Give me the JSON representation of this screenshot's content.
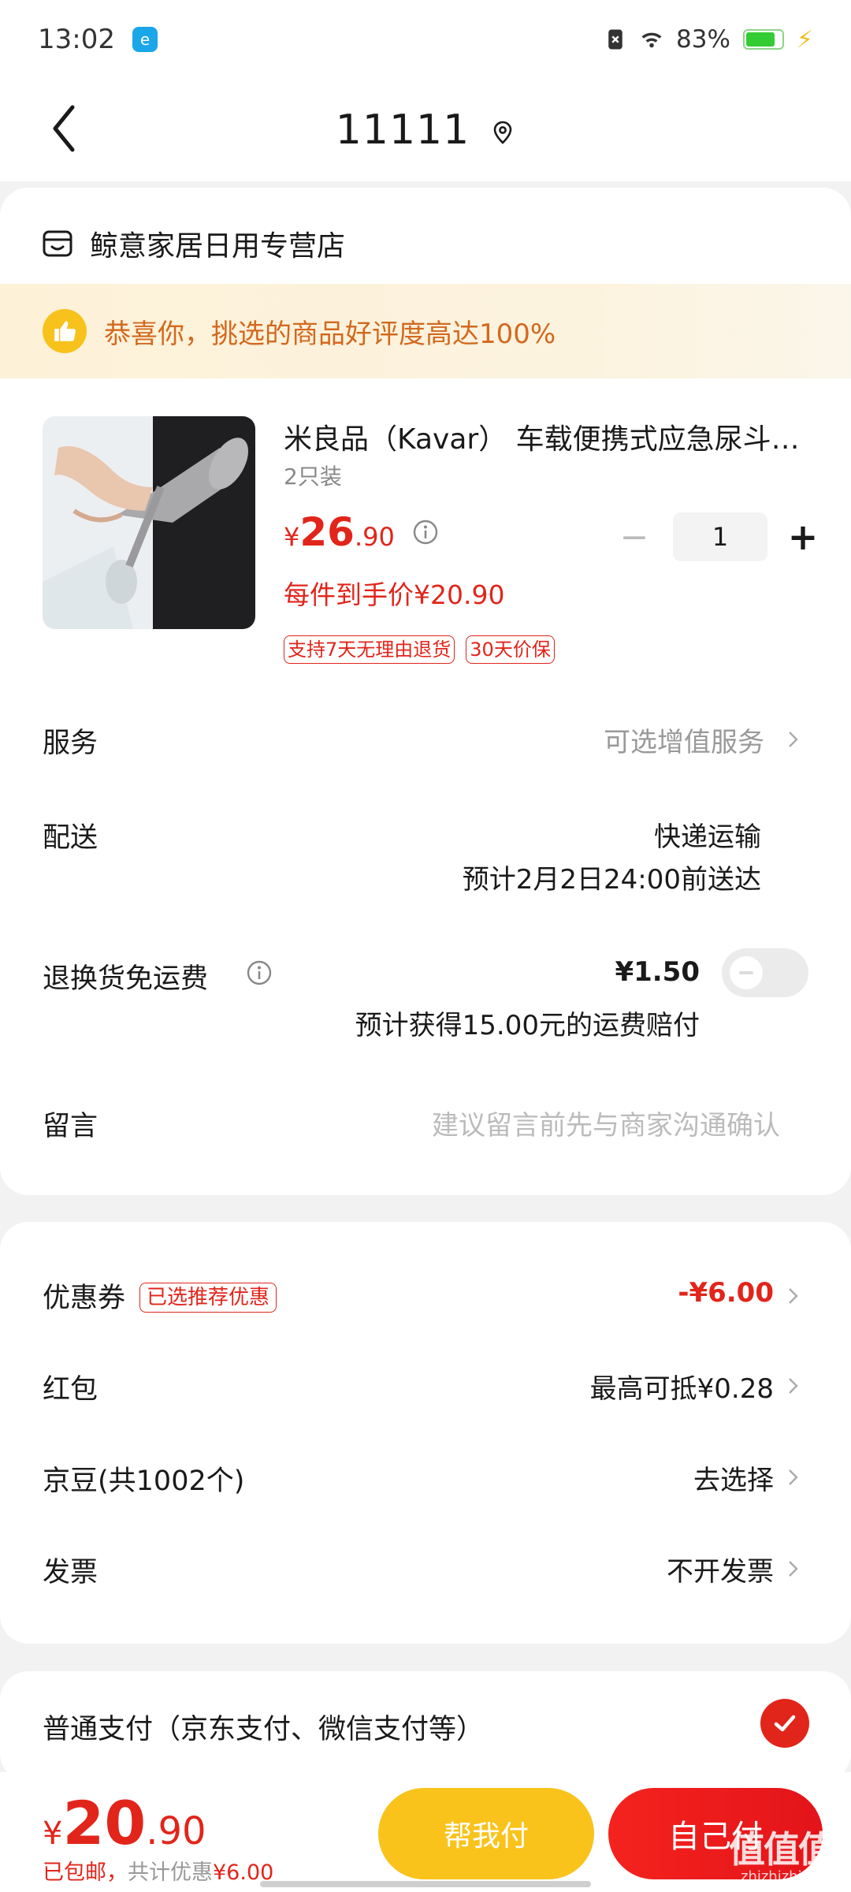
{
  "status_bar": {
    "time": "13:02",
    "app_badge": "e",
    "battery": "83%",
    "battery_level": 0.83
  },
  "header": {
    "title": "11111"
  },
  "store": {
    "name": "鲸意家居日用专营店"
  },
  "banner": {
    "text": "恭喜你，挑选的商品好评度高达100%"
  },
  "product": {
    "title": "米良品（Kavar） 车载便携式应急尿斗尿壶",
    "spec": "2只装",
    "price_symbol": "¥",
    "price_int": "26",
    "price_dec": ".90",
    "quantity": "1",
    "minus": "−",
    "plus": "+",
    "final_price": "每件到手价¥20.90",
    "tags": [
      "支持7天无理由退货",
      "30天价保"
    ]
  },
  "service": {
    "label": "服务",
    "value": "可选增值服务"
  },
  "delivery": {
    "label": "配送",
    "method": "快递运输",
    "eta": "预计2月2日24:00前送达"
  },
  "return_shipping": {
    "label": "退换货免运费",
    "price": "¥1.50",
    "note": "预计获得15.00元的运费赔付",
    "enabled": false
  },
  "message": {
    "label": "留言",
    "placeholder": "建议留言前先与商家沟通确认"
  },
  "coupon": {
    "label": "优惠券",
    "badge": "已选推荐优惠",
    "value": "-¥6.00"
  },
  "red_packet": {
    "label": "红包",
    "value": "最高可抵¥0.28"
  },
  "jd_beans": {
    "label": "京豆(共1002个)",
    "value": "去选择"
  },
  "invoice": {
    "label": "发票",
    "value": "不开发票"
  },
  "payment": {
    "label": "普通支付（京东支付、微信支付等）",
    "selected": true
  },
  "footer": {
    "total_symbol": "¥",
    "total_int": "20",
    "total_dec": ".90",
    "shipping_note": "已包邮，",
    "discount_note": "共计优惠",
    "discount_value": "¥6.00",
    "help_pay": "帮我付",
    "self_pay": "自己付",
    "watermark": "值值值",
    "watermark_url": "zhizhizhi.com"
  },
  "colors": {
    "accent_red": "#e1251b",
    "help_button": "#f9c31c",
    "banner_text": "#d2691e"
  }
}
